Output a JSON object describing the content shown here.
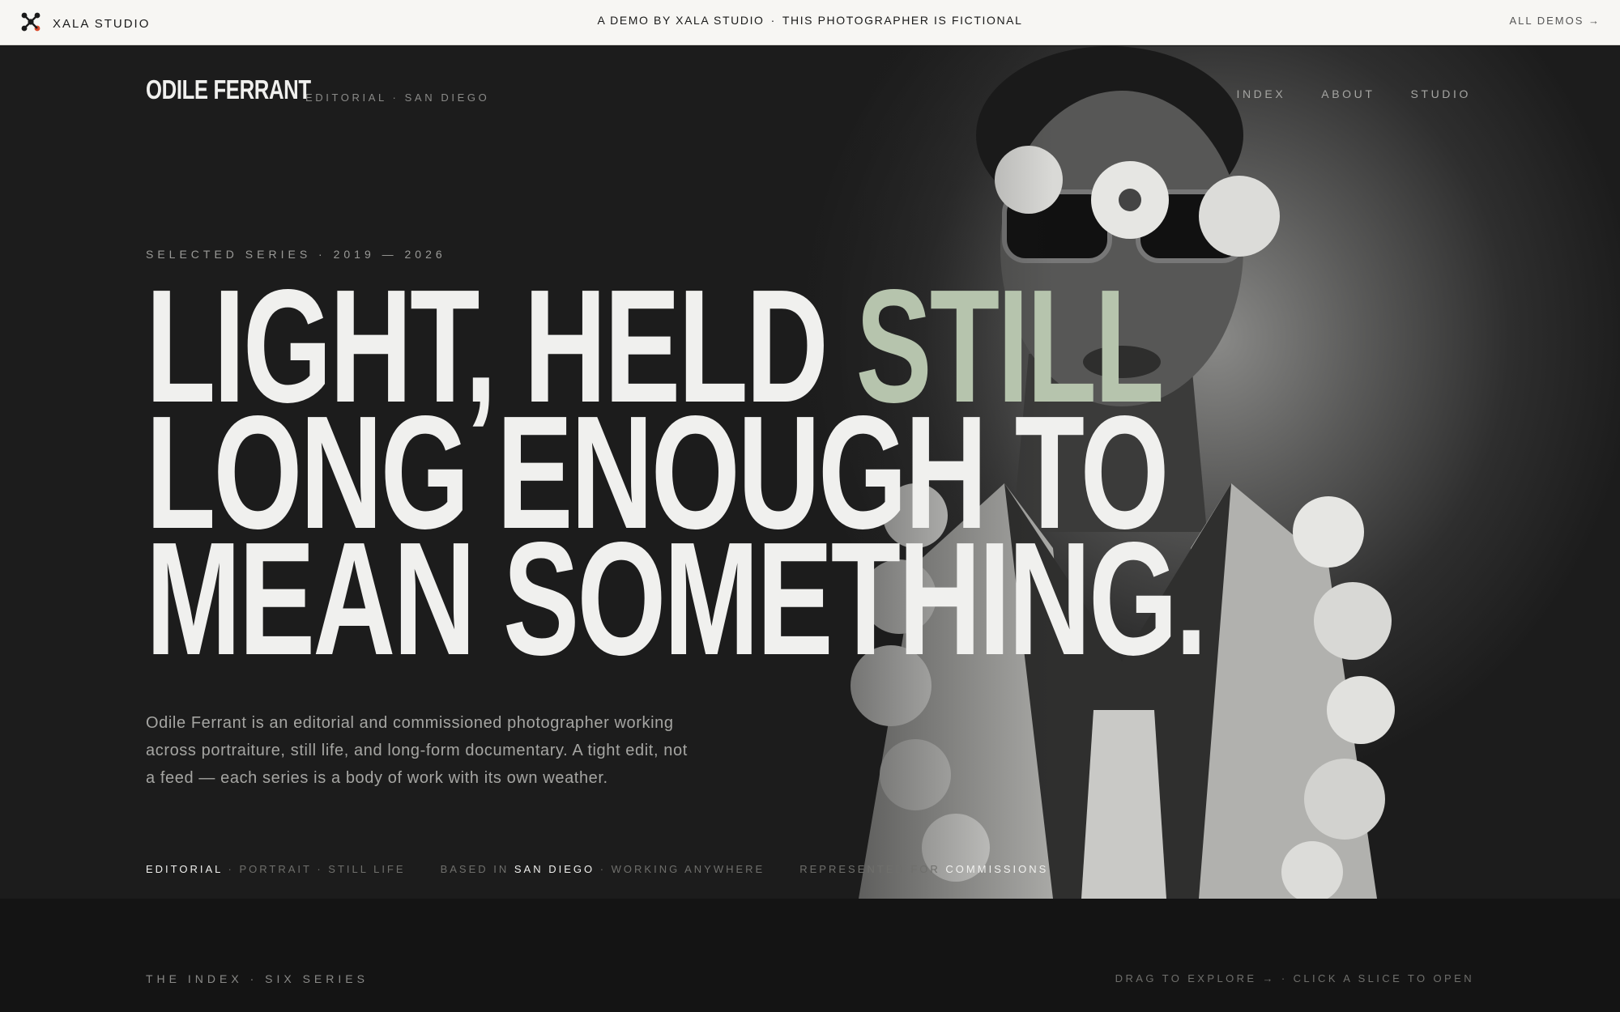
{
  "demo_bar": {
    "brand": "XALA STUDIO",
    "notice_left": "A DEMO BY XALA STUDIO",
    "separator": "·",
    "notice_right": "THIS PHOTOGRAPHER IS FICTIONAL",
    "all_demos": "ALL DEMOS →"
  },
  "site": {
    "name": "ODILE FERRANT",
    "tagline": "EDITORIAL · SAN DIEGO",
    "nav": [
      "INDEX",
      "ABOUT",
      "STUDIO"
    ]
  },
  "hero": {
    "eyebrow": "SELECTED SERIES · 2019 — 2026",
    "headline": {
      "line1_main": "LIGHT, HELD ",
      "line1_accent": "STILL",
      "line2": "LONG ENOUGH TO",
      "line3": "MEAN SOMETHING."
    },
    "intro": "Odile Ferrant is an editorial and commissioned photographer working across portraiture, still life, and long-form documentary. A tight edit, not a feed — each series is a body of work with its own weather.",
    "meta": {
      "disciplines_hl": "EDITORIAL",
      "disciplines_rest": " · PORTRAIT · STILL LIFE",
      "based_pre": "BASED IN ",
      "based_hl": "SAN DIEGO",
      "based_post": " · WORKING ANYWHERE",
      "rep_pre": "REPRESENTED FOR ",
      "rep_hl": "COMMISSIONS"
    }
  },
  "index": {
    "label": "THE INDEX · SIX SERIES",
    "hint": "DRAG TO EXPLORE → · CLICK A SLICE TO OPEN"
  },
  "colors": {
    "background": "#141414",
    "hero_background": "#1c1c1c",
    "accent": "#b6c4ad",
    "text": "#f0f0ee",
    "demo_bar": "#f7f6f3"
  },
  "icons": [
    "xala-logo-icon",
    "arrow-right-icon"
  ]
}
